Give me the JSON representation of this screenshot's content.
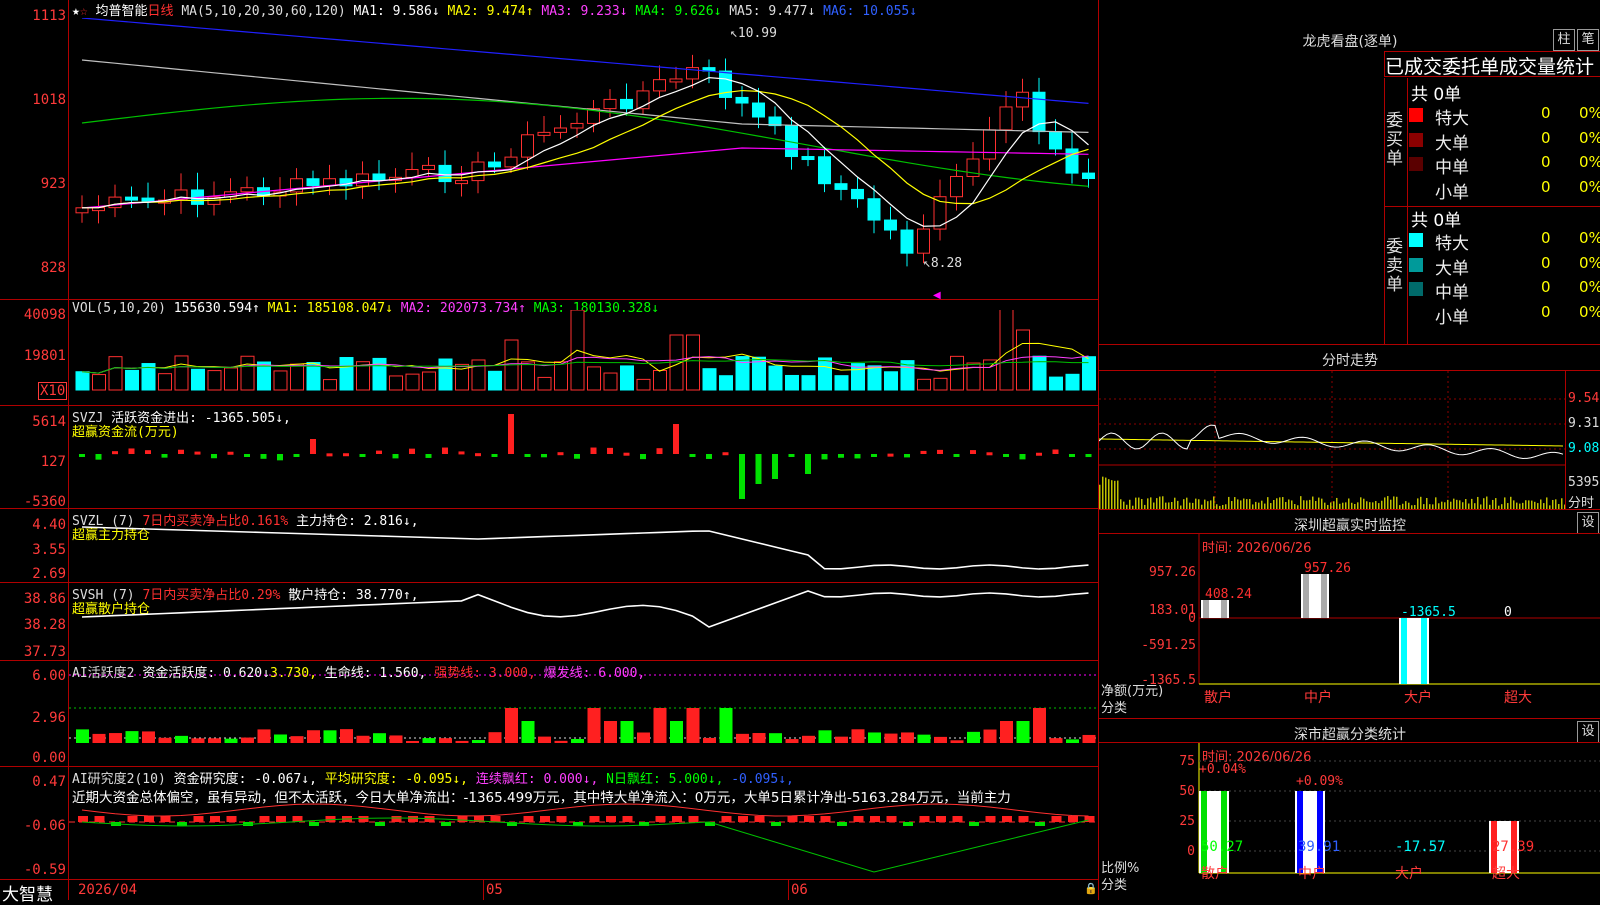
{
  "header": {
    "stock_name": "均普智能",
    "period": "日线",
    "ma_params": "MA(5,10,20,30,60,120)",
    "ma1": "MA1: 9.586↓",
    "ma2": "MA2: 9.474↑",
    "ma3": "MA3: 9.233↓",
    "ma4": "MA4: 9.626↓",
    "ma5": "MA5: 9.477↓",
    "ma6": "MA6: 10.055↓"
  },
  "price_axis": [
    "1113",
    "1018",
    "923",
    "828"
  ],
  "price_marks": {
    "high": "10.99",
    "low": "8.28"
  },
  "vol": {
    "title": "VOL(5,10,20)",
    "value": "155630.594↑",
    "ma1": "MA1: 185108.047↓",
    "ma2": "MA2: 202073.734↑",
    "ma3": "MA3: 180130.328↓",
    "axis": [
      "40098",
      "19801",
      "X10"
    ]
  },
  "svzj": {
    "title": "SVZJ",
    "label": "活跃资金进出: -1365.505↓,",
    "sub": "超赢资金流(万元)",
    "axis": [
      "5614",
      "127",
      "-5360"
    ]
  },
  "svzl": {
    "title": "SVZL (7)",
    "label1": "7日内买卖净占比0.161%",
    "label2": "主力持仓: 2.816↓,",
    "sub": "超赢主力持仓",
    "axis": [
      "4.40",
      "3.55",
      "2.69"
    ]
  },
  "svsh": {
    "title": "SVSH (7)",
    "label1": "7日内买卖净占比0.29%",
    "label2": "散户持仓: 38.770↑,",
    "sub": "超赢散户持仓",
    "axis": [
      "38.86",
      "38.28",
      "37.73"
    ]
  },
  "ai1": {
    "title": "AI活跃度2",
    "a": "资金活跃度: 0.620↓",
    "b": "3.730,",
    "c": "生命线: 1.560,",
    "d": "强势线: 3.000,",
    "e": "爆发线: 6.000,",
    "axis": [
      "6.00",
      "2.96",
      "0.00"
    ]
  },
  "ai2": {
    "title": "AI研究度2(10)",
    "a": "资金研究度: -0.067↓,",
    "b": "平均研究度: -0.095↓,",
    "c": "连续飘红: 0.000↓,",
    "d": "N日飘红: 5.000↓,",
    "e": "-0.095↓,",
    "summary": "近期大资金总体偏空，虽有异动，但不太活跃，今日大单净流出：-1365.499万元，其中特大单净流入：0万元，大单5日累计净出-5163.284万元，当前主力",
    "axis": [
      "0.47",
      "-0.06",
      "-0.59"
    ]
  },
  "date_axis": {
    "start": "2026/04",
    "m5": "05",
    "m6": "06"
  },
  "logo": "大智慧",
  "right": {
    "dragon_title": "龙虎看盘(逐单)",
    "btn_zhu": "柱",
    "btn_bi": "笔",
    "tabs": "已成交委托单成交量统计",
    "buy_group": "委买单",
    "sell_group": "委卖单",
    "buy_total": "共 0单",
    "sell_total": "共 0单",
    "buy_rows": [
      {
        "name": "特大",
        "v": "0",
        "p": "0%",
        "color": "#ff0000"
      },
      {
        "name": "大单",
        "v": "0",
        "p": "0%",
        "color": "#8b0000"
      },
      {
        "name": "中单",
        "v": "0",
        "p": "0%",
        "color": "#5a0000"
      },
      {
        "name": "小单",
        "v": "0",
        "p": "0%",
        "color": "#000000"
      }
    ],
    "sell_rows": [
      {
        "name": "特大",
        "v": "0",
        "p": "0%",
        "color": "#00ffff"
      },
      {
        "name": "大单",
        "v": "0",
        "p": "0%",
        "color": "#009a9a"
      },
      {
        "name": "中单",
        "v": "0",
        "p": "0%",
        "color": "#006a6a"
      },
      {
        "name": "小单",
        "v": "0",
        "p": "0%",
        "color": "#000000"
      }
    ],
    "intraday_title": "分时走势",
    "intraday_axis": [
      "9.54",
      "9.31",
      "9.08",
      "5395",
      "分时"
    ],
    "sz_monitor_title": "深圳超赢实时监控",
    "set1": "设",
    "sz_time": "时间: 2026/06/26",
    "sz_axis": [
      "957.26",
      "183.01",
      "0",
      "-591.25",
      "-1365.5"
    ],
    "sz_values": {
      "sanhu": "408.24",
      "zhonghu": "957.26",
      "dahu": "-1365.5",
      "chaoda": "0"
    },
    "sz_ylabel": "净额(万元)",
    "sz_xlabel": "分类",
    "cats": [
      "散户",
      "中户",
      "大户",
      "超大"
    ],
    "sc_title": "深市超赢分类统计",
    "set2": "设",
    "sc_time": "时间: 2026/06/26",
    "sc_axis": [
      "75",
      "50",
      "25",
      "0"
    ],
    "sc_pct": {
      "sanhu": "+0.04%",
      "zhonghu": "+0.09%"
    },
    "sc_values": [
      "50.27",
      "39.91",
      "-17.57",
      "27.39"
    ],
    "sc_ylabel": "比例%",
    "sc_xlabel": "分类"
  }
}
